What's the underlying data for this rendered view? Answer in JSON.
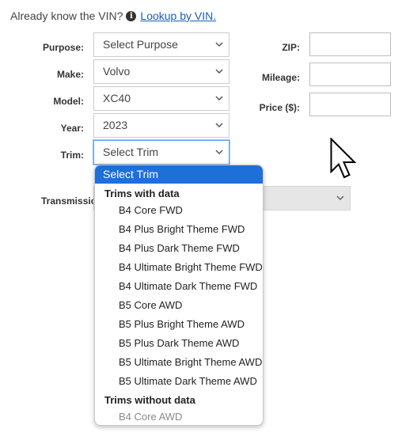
{
  "vin_prompt": {
    "text": "Already know the VIN?",
    "info_icon": "info-circle-icon",
    "link_label": "Lookup by VIN."
  },
  "form": {
    "purpose": {
      "label": "Purpose:",
      "value": "Select Purpose"
    },
    "make": {
      "label": "Make:",
      "value": "Volvo"
    },
    "model": {
      "label": "Model:",
      "value": "XC40"
    },
    "year": {
      "label": "Year:",
      "value": "2023"
    },
    "trim": {
      "label": "Trim:",
      "value": "Select Trim"
    },
    "transmission": {
      "label": "Transmissio",
      "value": ""
    },
    "zip": {
      "label": "ZIP:",
      "value": ""
    },
    "mileage": {
      "label": "Mileage:",
      "value": ""
    },
    "price": {
      "label": "Price ($):",
      "value": ""
    }
  },
  "trim_dropdown": {
    "selected_label": "Select Trim",
    "groups": [
      {
        "label": "Trims with data",
        "options": [
          "B4 Core FWD",
          "B4 Plus Bright Theme FWD",
          "B4 Plus Dark Theme FWD",
          "B4 Ultimate Bright Theme FWD",
          "B4 Ultimate Dark Theme FWD",
          "B5 Core AWD",
          "B5 Plus Bright Theme AWD",
          "B5 Plus Dark Theme AWD",
          "B5 Ultimate Bright Theme AWD",
          "B5 Ultimate Dark Theme AWD"
        ]
      },
      {
        "label": "Trims without data",
        "options": [
          "B4 Core AWD"
        ]
      }
    ]
  },
  "colors": {
    "accent": "#1e6fd9",
    "link": "#1a5fb4"
  }
}
